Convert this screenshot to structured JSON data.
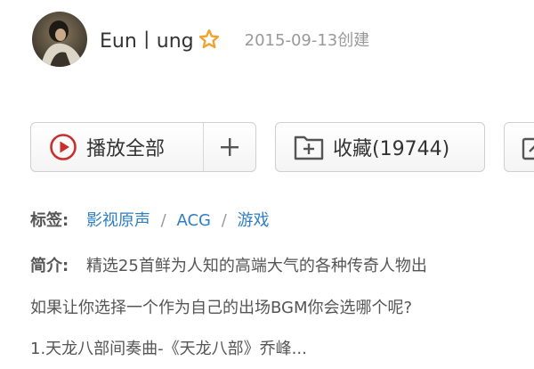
{
  "creator": {
    "name": "Eun丨ung",
    "created": "2015-09-13创建",
    "badge_icon": "star-outline-icon",
    "badge_color": "#f0a32f"
  },
  "actions": {
    "play_all_label": "播放全部",
    "add_label": "+",
    "collect_label": "收藏(19744)"
  },
  "tags": {
    "label": "标签:",
    "items": [
      "影视原声",
      "ACG",
      "游戏"
    ],
    "separator": "/",
    "link_color": "#2f7ec3"
  },
  "intro": {
    "label": "简介:",
    "lines": [
      "精选25首鲜为人知的高端大气的各种传奇人物出",
      "如果让你选择一个作为自己的出场BGM你会选哪个呢?",
      "1.天龙八部间奏曲-《天龙八部》乔峰..."
    ]
  },
  "colors": {
    "accent_red": "#c9302c",
    "text_muted": "#999999"
  }
}
